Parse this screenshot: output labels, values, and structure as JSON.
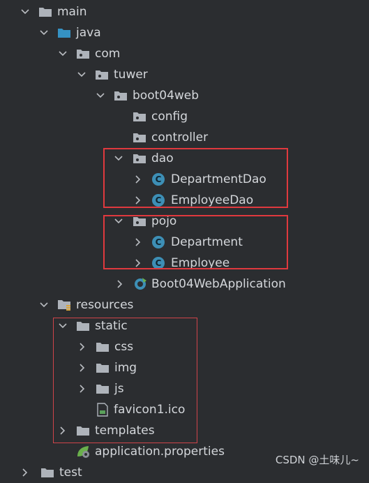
{
  "tree": {
    "main": "main",
    "java": "java",
    "com": "com",
    "tuwer": "tuwer",
    "boot04web": "boot04web",
    "config": "config",
    "controller": "controller",
    "dao": "dao",
    "departmentDao": "DepartmentDao",
    "employeeDao": "EmployeeDao",
    "pojo": "pojo",
    "department": "Department",
    "employee": "Employee",
    "app": "Boot04WebApplication",
    "resources": "resources",
    "static": "static",
    "css": "css",
    "img": "img",
    "js": "js",
    "favicon": "favicon1.ico",
    "templates": "templates",
    "properties": "application.properties",
    "test": "test"
  },
  "class_icon_letter": "C",
  "watermark": "CSDN @土味儿~",
  "colors": {
    "background": "#2b2d30",
    "folder": "#aeb3ba",
    "source_folder": "#3592c4",
    "class_badge": "#3d8fb6",
    "highlight_box": "#e0393e"
  }
}
